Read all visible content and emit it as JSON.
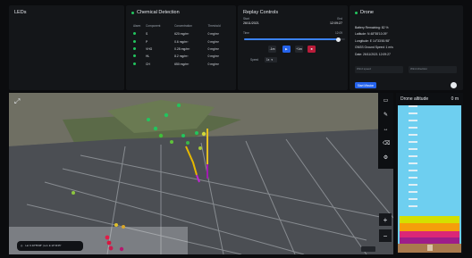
{
  "leds": {
    "title": "LEDs"
  },
  "chemical": {
    "title": "Chemical Detection",
    "columns": [
      "Alarm",
      "Component",
      "Concentration",
      "Threshold"
    ],
    "rows": [
      {
        "component": "S",
        "concentration": "620 mg/m³",
        "threshold": "0 mg/m³"
      },
      {
        "component": "P",
        "concentration": "0.6 mg/m³",
        "threshold": "0 mg/m³"
      },
      {
        "component": "VHG",
        "concentration": "0.28 mg/m³",
        "threshold": "0 mg/m³"
      },
      {
        "component": "HL",
        "concentration": "8.2 mg/m³",
        "threshold": "0 mg/m³"
      },
      {
        "component": "CH",
        "concentration": "650 mg/m³",
        "threshold": "0 mg/m³"
      }
    ]
  },
  "replay": {
    "title": "Replay Controls",
    "start_label": "Start",
    "start_value": "26/11/2021",
    "end_label": "End",
    "end_value": "12:09:27",
    "time_label": "Time",
    "time_value": "12:09",
    "slider_progress": 0.93,
    "buttons": {
      "rewind": "-1m",
      "play": "▶",
      "forward": "+1m",
      "stop": "■"
    },
    "speed_label": "Speed",
    "speed_value": "1x"
  },
  "drone": {
    "title": "Drone",
    "battery": "Battery Remaining: 82 %",
    "latitude": "Latitude: N 48°55'10.09\"",
    "longitude": "Longitude: E 14°33'45.98\"",
    "speed": "GNSS Ground Speed: 1 m/s",
    "date": "Date: 26/11/2021 12:09:27",
    "input1_placeholder": "Wind speed",
    "input2_placeholder": "Wind direction",
    "button_label": "Start Mission"
  },
  "map": {
    "coords": "Lat: N 48°55'08\" | Lon: E 14°33'45\"",
    "zoom_in": "+",
    "zoom_out": "−"
  },
  "altitude": {
    "title": "Drone altitude",
    "value": "0 m"
  },
  "colors": {
    "accent": "#3b82f6",
    "ok": "#22c55e",
    "sky": "#6ecff0"
  }
}
